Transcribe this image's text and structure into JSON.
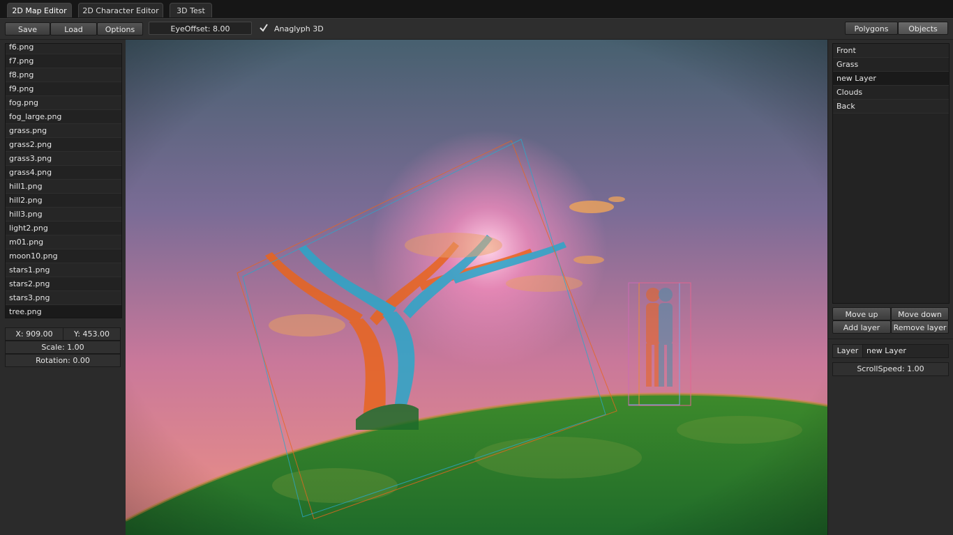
{
  "tabs": [
    "2D Map Editor",
    "2D Character Editor",
    "3D Test"
  ],
  "toolbar": {
    "save": "Save",
    "load": "Load",
    "options": "Options",
    "eye_offset": "EyeOffset: 8.00",
    "anaglyph_label": "Anaglyph 3D",
    "anaglyph_checked": true,
    "polygons": "Polygons",
    "objects": "Objects"
  },
  "files": [
    "f6.png",
    "f7.png",
    "f8.png",
    "f9.png",
    "fog.png",
    "fog_large.png",
    "grass.png",
    "grass2.png",
    "grass3.png",
    "grass4.png",
    "hill1.png",
    "hill2.png",
    "hill3.png",
    "light2.png",
    "m01.png",
    "moon10.png",
    "stars1.png",
    "stars2.png",
    "stars3.png",
    "tree.png"
  ],
  "props": {
    "x": "X: 909.00",
    "y": "Y: 453.00",
    "scale": "Scale: 1.00",
    "rotation": "Rotation: 0.00"
  },
  "layers": [
    "Front",
    "Grass",
    "new Layer",
    "Clouds",
    "Back"
  ],
  "layer_buttons": {
    "move_up": "Move up",
    "move_down": "Move down",
    "add": "Add layer",
    "remove": "Remove layer"
  },
  "layer_props": {
    "label": "Layer",
    "name": "new Layer",
    "scroll_speed": "ScrollSpeed: 1.00"
  },
  "colors": {
    "anaglyph_red": "#e8651e",
    "anaglyph_cyan": "#2aa7c9",
    "grass": "#2f8a2a",
    "sky_top": "#4a5f74",
    "sky_bottom": "#e88c92"
  }
}
